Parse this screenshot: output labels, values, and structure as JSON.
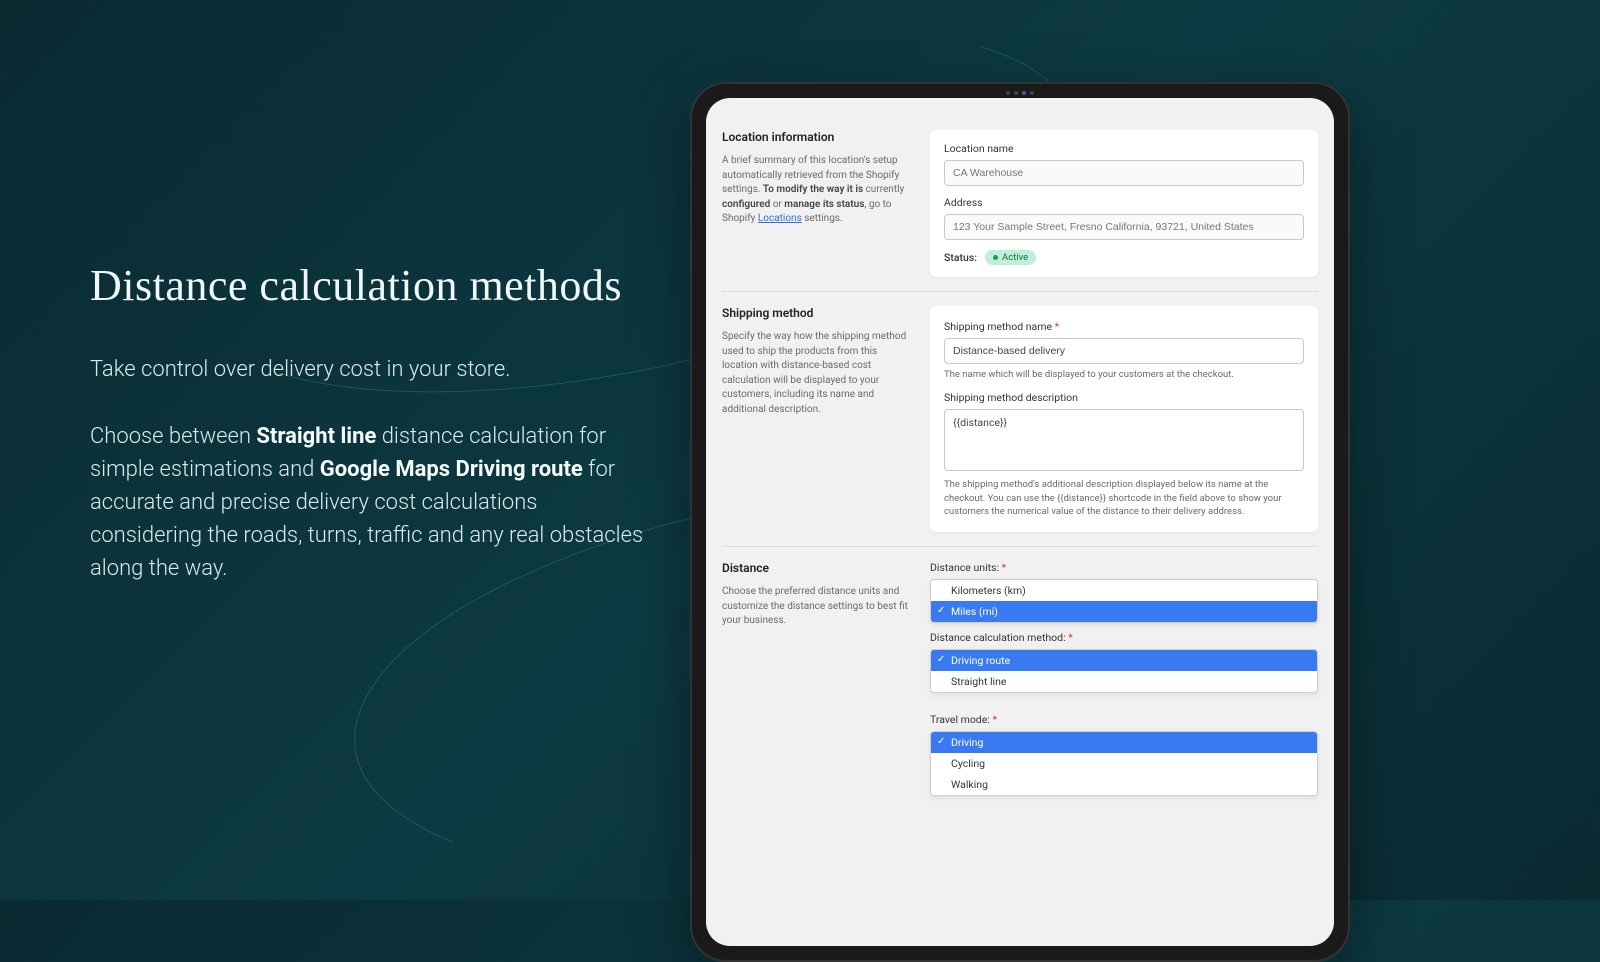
{
  "marketing": {
    "headline": "Distance calculation methods",
    "sub1": "Take control over delivery cost in your store.",
    "body_pre": "Choose between ",
    "body_b1": "Straight line",
    "body_mid1": " distance calculation for simple estimations and ",
    "body_b2": "Google Maps Driving route",
    "body_post": " for accurate and precise delivery cost calculations considering the roads, turns, traffic and any real obstacles along the way."
  },
  "loc_section": {
    "title": "Location information",
    "desc_pre": "A brief summary of this location's setup automatically retrieved from the Shopify settings. ",
    "desc_b1": "To modify the way it is",
    "desc_mid1": " currently ",
    "desc_b2": "configured",
    "desc_mid2": " or ",
    "desc_b3": "manage its status",
    "desc_mid3": ", go to Shopify ",
    "desc_link": "Locations",
    "desc_post": " settings.",
    "name_label": "Location name",
    "name_value": "CA Warehouse",
    "addr_label": "Address",
    "addr_value": "123 Your Sample Street, Fresno California, 93721, United States",
    "status_label": "Status:",
    "status_badge": "Active"
  },
  "ship_section": {
    "title": "Shipping method",
    "desc": "Specify the way how the shipping method used to ship the products from this location with distance-based cost calculation will be displayed to your customers, including its name and additional description.",
    "name_label": "Shipping method name ",
    "name_value": "Distance-based delivery",
    "name_help": "The name which will be displayed to your customers at the checkout.",
    "desc_label": "Shipping method description",
    "desc_value": "{{distance}}",
    "desc_help": "The shipping method's additional description displayed below its name at the checkout. You can use the {{distance}} shortcode in the field above to show your customers the numerical value of the distance to their delivery address."
  },
  "dist_section": {
    "title": "Distance",
    "desc": "Choose the preferred distance units and customize the distance settings to best fit your business.",
    "units_label": "Distance units: ",
    "units_opts": [
      "Kilometers (km)",
      "Miles (mi)"
    ],
    "units_selected": 1,
    "method_label": "Distance calculation method: ",
    "method_opts": [
      "Driving route",
      "Straight line"
    ],
    "method_selected": 0,
    "travel_label": "Travel mode: ",
    "travel_opts": [
      "Driving",
      "Cycling",
      "Walking"
    ],
    "travel_selected": 0
  }
}
